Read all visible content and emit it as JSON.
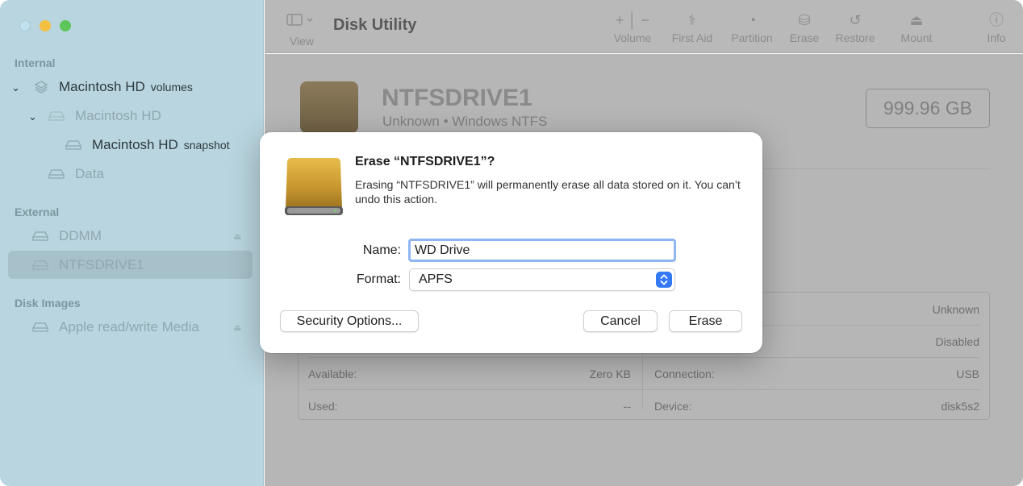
{
  "sidebar": {
    "sections": {
      "internal": "Internal",
      "external": "External",
      "disk_images": "Disk Images"
    },
    "items": [
      {
        "label": "Macintosh HD",
        "sublabel": "volumes"
      },
      {
        "label": "Macintosh HD",
        "sublabel": ""
      },
      {
        "label": "Macintosh HD",
        "sublabel": "snapshot"
      },
      {
        "label": "Data",
        "sublabel": ""
      },
      {
        "label": "DDMM",
        "sublabel": ""
      },
      {
        "label": "NTFSDRIVE1",
        "sublabel": ""
      },
      {
        "label": "Apple read/write Media",
        "sublabel": ""
      }
    ]
  },
  "toolbar": {
    "view_label": "View",
    "title": "Disk Utility",
    "buttons": [
      {
        "label": "Volume",
        "icon": "plus-minus-icon"
      },
      {
        "label": "First Aid",
        "icon": "stethoscope-icon"
      },
      {
        "label": "Partition",
        "icon": "pie-icon"
      },
      {
        "label": "Erase",
        "icon": "eraser-icon"
      },
      {
        "label": "Restore",
        "icon": "restore-icon"
      },
      {
        "label": "Mount",
        "icon": "mount-icon"
      },
      {
        "label": "Info",
        "icon": "info-icon"
      }
    ]
  },
  "main": {
    "disk_name": "NTFSDRIVE1",
    "disk_subtitle": "Unknown • Windows NTFS",
    "capacity": "999.96 GB",
    "info": {
      "left": [
        {
          "label": "Available:",
          "value": "Zero KB"
        },
        {
          "label": "Used:",
          "value": "--"
        }
      ],
      "right": [
        {
          "label": "",
          "value": "Unknown"
        },
        {
          "label": "",
          "value": "Disabled"
        },
        {
          "label": "Connection:",
          "value": "USB"
        },
        {
          "label": "Device:",
          "value": "disk5s2"
        }
      ]
    }
  },
  "dialog": {
    "title": "Erase “NTFSDRIVE1”?",
    "message": "Erasing “NTFSDRIVE1” will permanently erase all data stored on it. You can’t undo this action.",
    "name_label": "Name:",
    "name_value": "WD Drive",
    "format_label": "Format:",
    "format_value": "APFS",
    "security_button": "Security Options...",
    "cancel_button": "Cancel",
    "erase_button": "Erase"
  },
  "colors": {
    "accent": "#3478f6",
    "sidebar_bg": "#b9d5df",
    "focus_ring": "#8fb6f0",
    "disk_gold": "#c9a03a"
  }
}
